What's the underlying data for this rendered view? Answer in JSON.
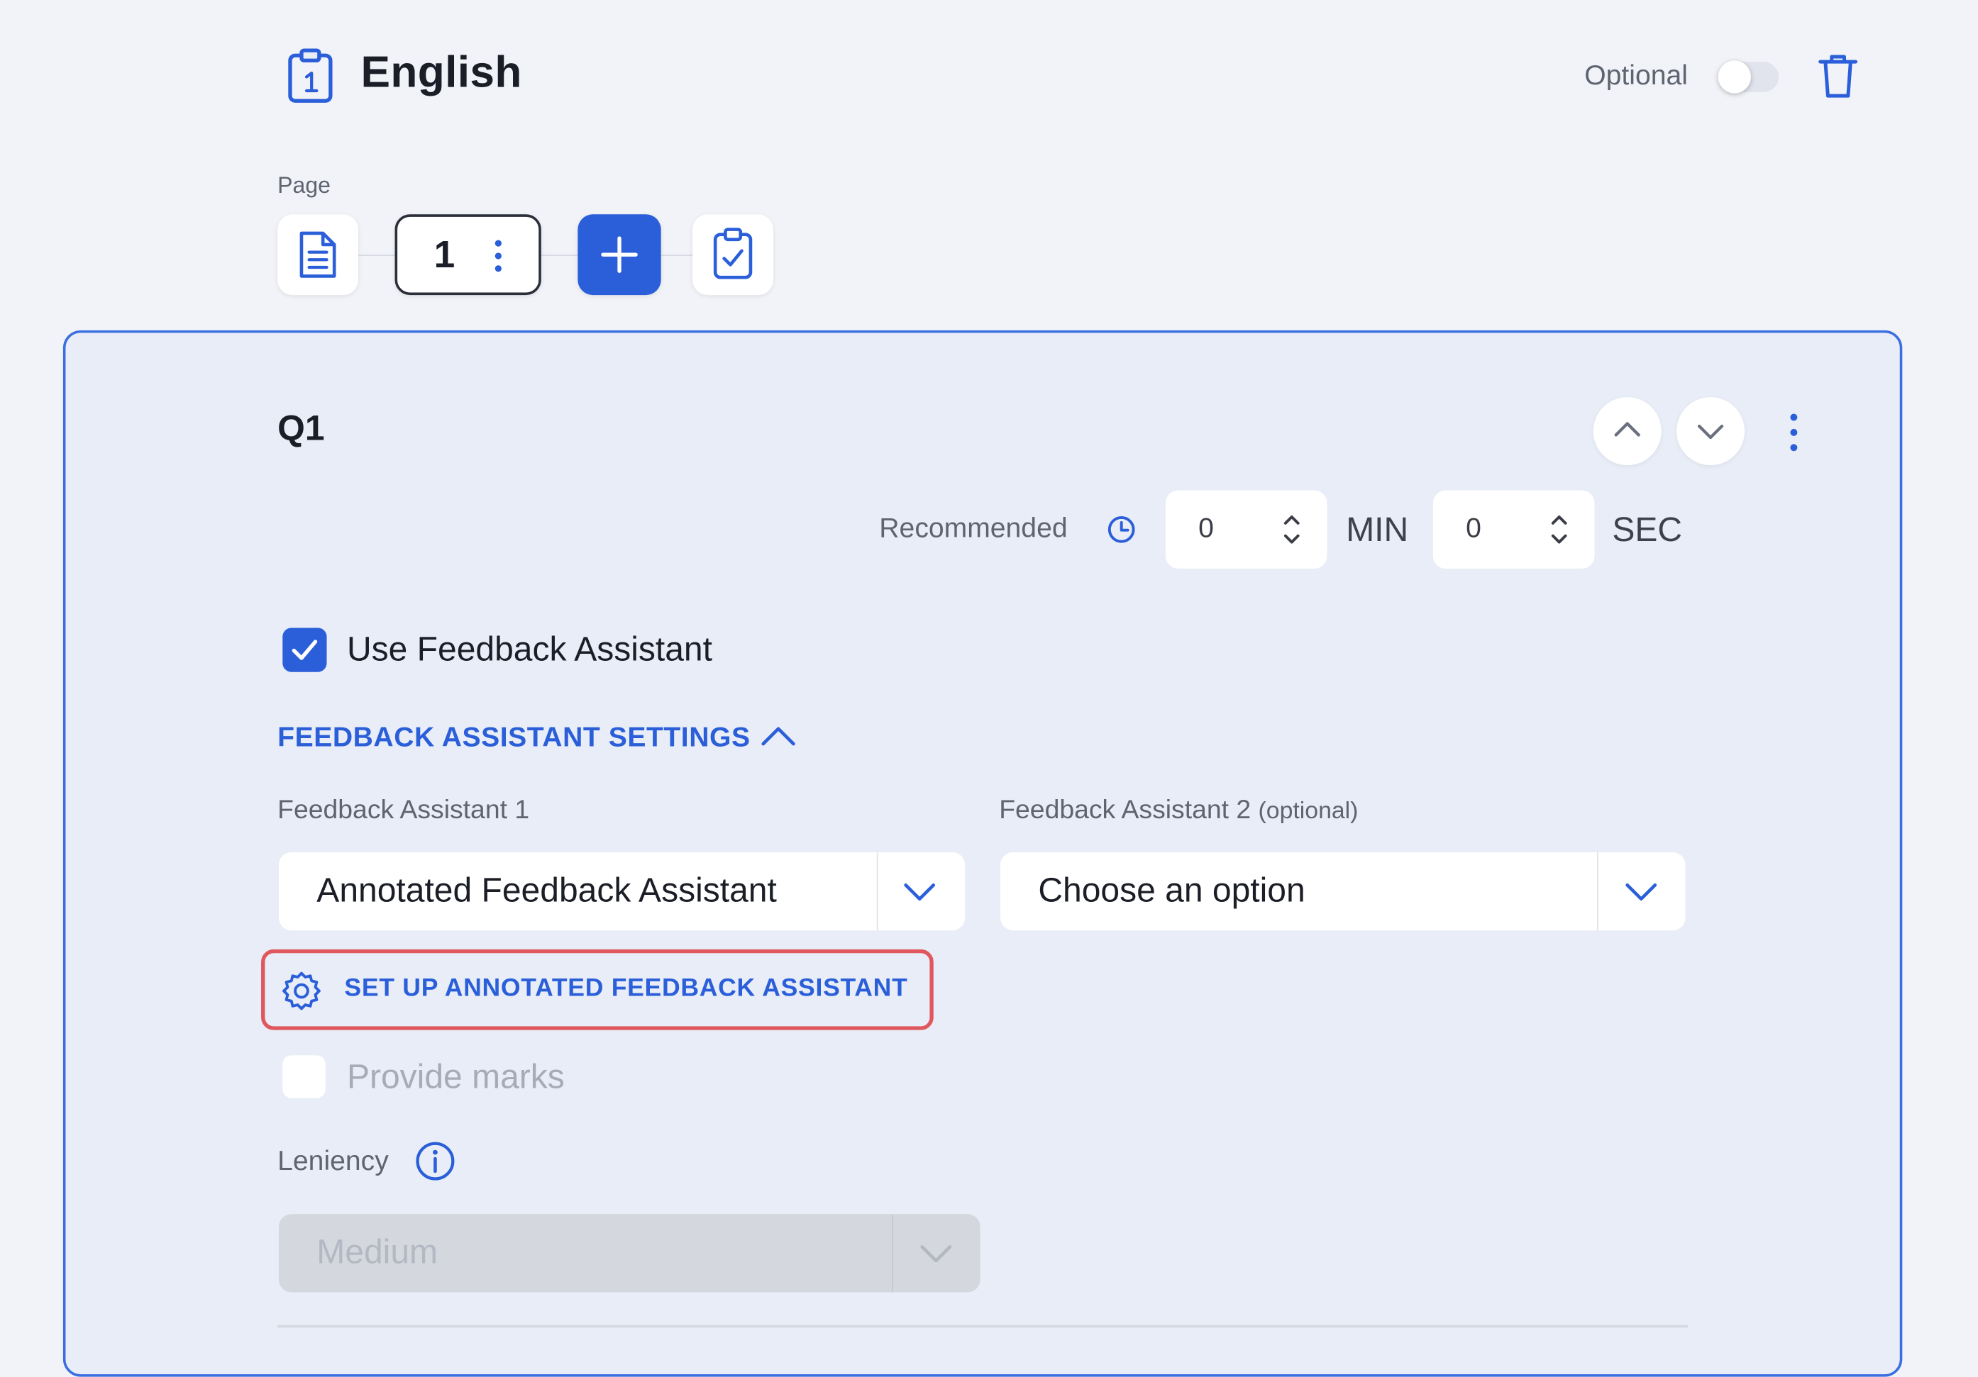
{
  "header": {
    "title": "English",
    "optional_label": "Optional",
    "optional_enabled": false,
    "icons": {
      "title": "clipboard-1-icon",
      "delete": "trash-icon"
    }
  },
  "page_bar": {
    "label": "Page",
    "current_page": "1",
    "icons": [
      "document-icon",
      "kebab-icon",
      "plus-icon",
      "clipboard-check-icon"
    ]
  },
  "question": {
    "label": "Q1",
    "recommended_label": "Recommended",
    "minutes": "0",
    "minutes_unit": "MIN",
    "seconds": "0",
    "seconds_unit": "SEC",
    "use_feedback_assistant_label": "Use Feedback Assistant",
    "use_feedback_assistant_checked": true
  },
  "settings": {
    "section_title": "FEEDBACK ASSISTANT SETTINGS",
    "expanded": true,
    "fa1_label": "Feedback Assistant 1",
    "fa1_value": "Annotated Feedback Assistant",
    "fa2_label": "Feedback Assistant 2",
    "fa2_optional_note": "(optional)",
    "fa2_placeholder": "Choose an option",
    "setup_link": "SET UP ANNOTATED FEEDBACK ASSISTANT",
    "provide_marks_label": "Provide marks",
    "provide_marks_checked": false,
    "leniency_label": "Leniency",
    "leniency_value": "Medium"
  },
  "colors": {
    "accent": "#2b5fd9",
    "highlight": "#e0575e",
    "card_background": "#e8edf7",
    "page_background": "#f1f3f8"
  }
}
